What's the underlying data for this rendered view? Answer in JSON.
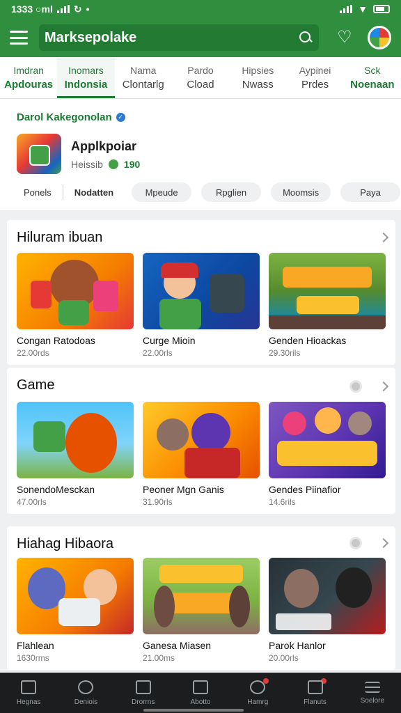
{
  "status": {
    "time": "1333 ○ml",
    "icons": [
      "signal-icon",
      "sync-icon",
      "dot-icon",
      "wifi-icon",
      "battery-icon"
    ]
  },
  "appbar": {
    "search_text": "Marksepolake"
  },
  "tabs": [
    {
      "l1": "Imdran",
      "l2": "Apdouras",
      "active": true
    },
    {
      "l1": "Inomars",
      "l2": "Indonsia",
      "active": true,
      "selected": true
    },
    {
      "l1": "Nama",
      "l2": "Clontarlg"
    },
    {
      "l1": "Pardo",
      "l2": "Cload"
    },
    {
      "l1": "Hipsies",
      "l2": "Nwass"
    },
    {
      "l1": "Aypinei",
      "l2": "Prdes"
    },
    {
      "l1": "Sck",
      "l2": "Noenaan",
      "active": true
    }
  ],
  "category": {
    "title": "Darol Kakegonolan",
    "app_name": "Applkpoiar",
    "app_meta": "Heissib",
    "app_count": "190",
    "chips": [
      "Ponels",
      "Nodatten",
      "Mpeude",
      "Rpglien",
      "Moomsis",
      "Paya"
    ]
  },
  "sections": [
    {
      "title": "Hiluram ibuan",
      "cards": [
        {
          "name": "Congan Ratodoas",
          "size": "22.00rds"
        },
        {
          "name": "Curge Mioin",
          "size": "22.00rls"
        },
        {
          "name": "Genden Hioackas",
          "size": "29.30rils"
        }
      ]
    },
    {
      "title": "Game",
      "cards": [
        {
          "name": "SonendoMesckan",
          "size": "47.00rls"
        },
        {
          "name": "Peoner Mgn Ganis",
          "size": "31.90rls"
        },
        {
          "name": "Gendes Piinafior",
          "size": "14.6rils"
        }
      ]
    },
    {
      "title": "Hiahag Hibaora",
      "cards": [
        {
          "name": "Flahlean",
          "size": "1630rms"
        },
        {
          "name": "Ganesa Miasen",
          "size": "21.00ms"
        },
        {
          "name": "Parok Hanlor",
          "size": "20.00rls"
        }
      ]
    }
  ],
  "bottom_nav": [
    "Hegnas",
    "Deniois",
    "Drorrns",
    "Abotto",
    "Hamrg",
    "Flanuts",
    "Soelore"
  ],
  "colors": {
    "brand": "#2f8f3f",
    "accent": "#1d7a34",
    "nav_bg": "#1b1d1f"
  }
}
